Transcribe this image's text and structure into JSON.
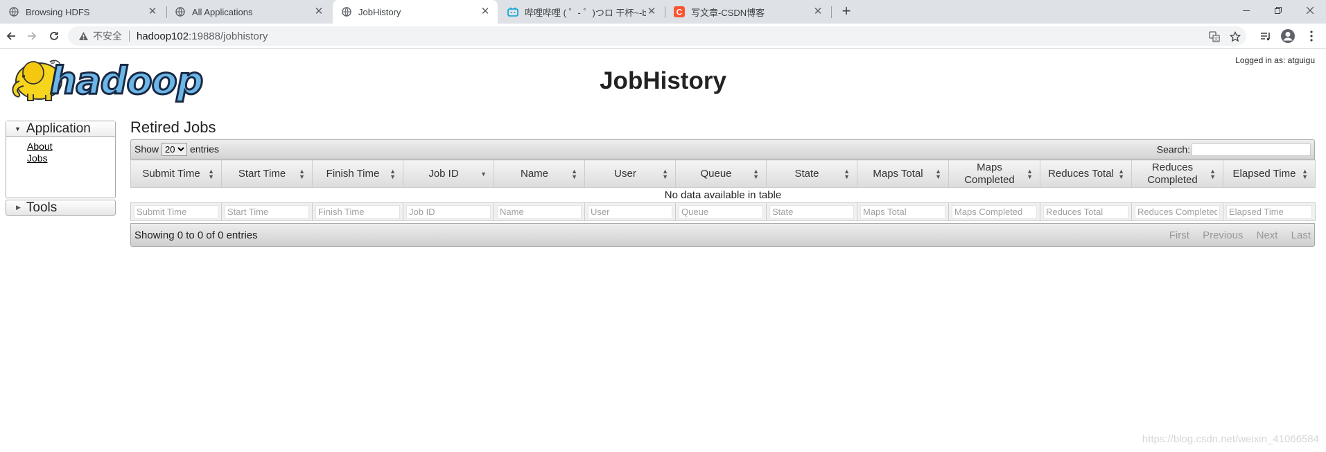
{
  "browser": {
    "tabs": [
      {
        "title": "Browsing HDFS",
        "icon": "globe-icon"
      },
      {
        "title": "All Applications",
        "icon": "globe-icon"
      },
      {
        "title": "JobHistory",
        "icon": "globe-icon",
        "active": true
      },
      {
        "title": "哔哩哔哩 ( ゜- ゜)つロ 干杯~-bili",
        "icon": "bilibili-icon"
      },
      {
        "title": "写文章-CSDN博客",
        "icon": "csdn-icon"
      }
    ],
    "new_tab": "+",
    "address": {
      "security_label": "不安全",
      "host": "hadoop102",
      "path": ":19888/jobhistory"
    }
  },
  "page": {
    "logo_text": "hadoop",
    "title": "JobHistory",
    "logged_in": "Logged in as: atguigu"
  },
  "sidebar": {
    "application": {
      "heading": "Application",
      "links": [
        "About",
        "Jobs"
      ]
    },
    "tools": {
      "heading": "Tools"
    }
  },
  "jobs": {
    "section_title": "Retired Jobs",
    "length": {
      "show": "Show",
      "value": "20",
      "entries": "entries"
    },
    "search_label": "Search:",
    "columns": [
      "Submit Time",
      "Start Time",
      "Finish Time",
      "Job ID",
      "Name",
      "User",
      "Queue",
      "State",
      "Maps Total",
      "Maps Completed",
      "Reduces Total",
      "Reduces Completed",
      "Elapsed Time"
    ],
    "empty_message": "No data available in table",
    "footer_info": "Showing 0 to 0 of 0 entries",
    "pager": [
      "First",
      "Previous",
      "Next",
      "Last"
    ]
  },
  "watermark": "https://blog.csdn.net/weixin_41066584"
}
